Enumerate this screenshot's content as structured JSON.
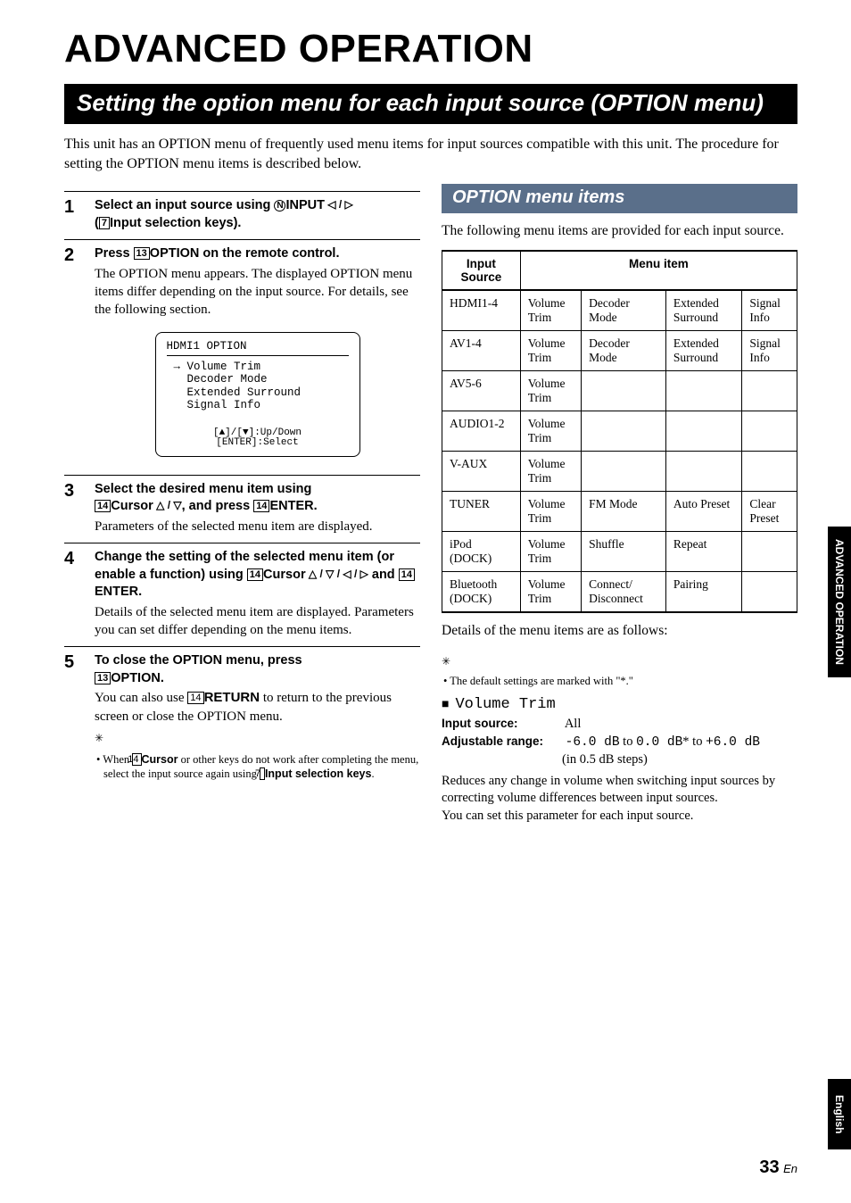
{
  "main_title": "ADVANCED OPERATION",
  "section_title": "Setting the option menu for each input source (OPTION menu)",
  "intro": "This unit has an OPTION menu of frequently used menu items for input sources compatible with this unit. The procedure for setting the OPTION menu items is described below.",
  "steps": {
    "s1": {
      "num": "1",
      "t1": "Select an input source using ",
      "circ": "N",
      "key1": "INPUT",
      "arrows": " ◁ / ▷",
      "t2": " (",
      "box": "7",
      "key2": "Input selection keys",
      "t3": ")."
    },
    "s2": {
      "num": "2",
      "t1": "Press ",
      "box": "13",
      "key1": "OPTION",
      "t2": " on the remote control.",
      "body": "The OPTION menu appears. The displayed OPTION menu items differ depending on the input source. For details, see the following section."
    },
    "s3": {
      "num": "3",
      "t1": "Select the desired menu item using ",
      "box": "14",
      "key1": "Cursor",
      "arrows": " △ / ▽",
      "t2": ", and press ",
      "box2": "14",
      "key2": "ENTER",
      "t3": ".",
      "body": "Parameters of the selected menu item are displayed."
    },
    "s4": {
      "num": "4",
      "t1": "Change the setting of the selected menu item (or enable a function) using ",
      "box": "14",
      "key1": "Cursor",
      "arrows": " △ / ▽ / ◁ / ▷",
      "t2": " and ",
      "box2": "14",
      "key2": "ENTER",
      "t3": ".",
      "body": "Details of the selected menu item are displayed. Parameters you can set differ depending on the menu items."
    },
    "s5": {
      "num": "5",
      "t1": "To close the OPTION menu, press ",
      "box": "13",
      "key1": "OPTION",
      "t2": ".",
      "body_a": "You can also use ",
      "box2": "14",
      "key2": "RETURN",
      "body_b": " to return to the previous screen or close the OPTION menu.",
      "note_a": "When ",
      "note_box": "14",
      "note_key": "Cursor",
      "note_b": " or other keys do not work after completing the menu, select the input source again using ",
      "note_box2": "7",
      "note_key2": "Input selection keys",
      "note_c": "."
    }
  },
  "osd": {
    "title": "HDMI1 OPTION",
    "items": "→ Volume Trim\n  Decoder Mode\n  Extended Surround\n  Signal Info",
    "hint1": "[▲]/[▼]:Up/Down",
    "hint2": "[ENTER]:Select"
  },
  "right": {
    "subheading": "OPTION menu items",
    "intro": "The following menu items are provided for each input source.",
    "th1": "Input Source",
    "th2": "Menu item",
    "rows": [
      {
        "src": "HDMI1-4",
        "c1": "Volume Trim",
        "c2": "Decoder Mode",
        "c3": "Extended Surround",
        "c4": "Signal Info"
      },
      {
        "src": "AV1-4",
        "c1": "Volume Trim",
        "c2": "Decoder Mode",
        "c3": "Extended Surround",
        "c4": "Signal Info"
      },
      {
        "src": "AV5-6",
        "c1": "Volume Trim",
        "c2": "",
        "c3": "",
        "c4": ""
      },
      {
        "src": "AUDIO1-2",
        "c1": "Volume Trim",
        "c2": "",
        "c3": "",
        "c4": ""
      },
      {
        "src": "V-AUX",
        "c1": "Volume Trim",
        "c2": "",
        "c3": "",
        "c4": ""
      },
      {
        "src": "TUNER",
        "c1": "Volume Trim",
        "c2": "FM Mode",
        "c3": "Auto Preset",
        "c4": "Clear Preset"
      },
      {
        "src": "iPod (DOCK)",
        "c1": "Volume Trim",
        "c2": "Shuffle",
        "c3": "Repeat",
        "c4": ""
      },
      {
        "src": "Bluetooth (DOCK)",
        "c1": "Volume Trim",
        "c2": "Connect/ Disconnect",
        "c3": "Pairing",
        "c4": ""
      }
    ],
    "after_table": "Details of the menu items are as follows:",
    "default_note": "The default settings are marked with \"*.\"",
    "vol_trim_title": "Volume Trim",
    "inp_src_label": "Input source:",
    "inp_src_val": "All",
    "adj_label": "Adjustable range:",
    "adj_a": "-6.0 dB",
    "adj_b": " to ",
    "adj_c": "0.0 dB",
    "adj_d": "* to ",
    "adj_e": "+6.0 dB",
    "adj_f": "(in 0.5 dB steps)",
    "desc1": "Reduces any change in volume when switching input sources by correcting volume differences between input sources.",
    "desc2": "You can set this parameter for each input source."
  },
  "side_tab": "ADVANCED OPERATION",
  "lang_tab": "English",
  "page": {
    "num": "33",
    "suffix": "En"
  }
}
